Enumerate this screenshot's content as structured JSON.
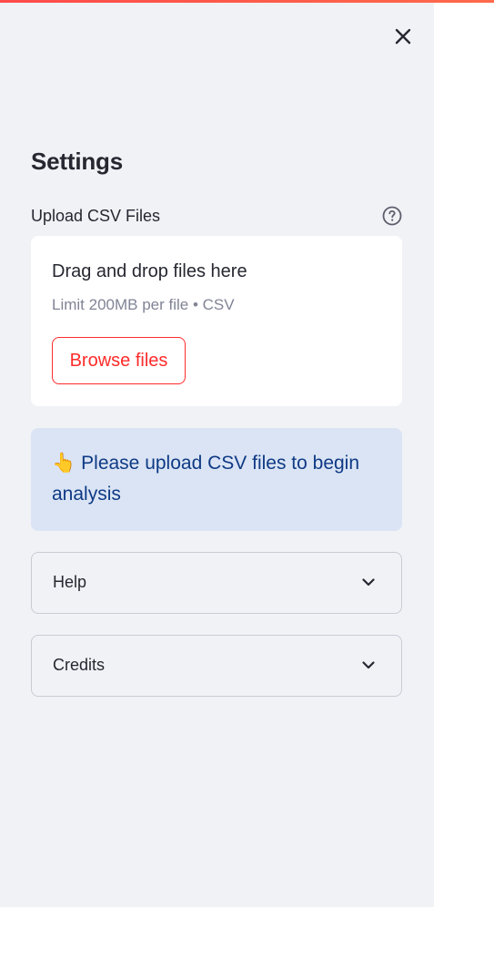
{
  "sidebar": {
    "close_icon": "close-icon",
    "heading": "Settings",
    "uploader": {
      "label": "Upload CSV Files",
      "help_icon": "question-circle-icon",
      "drop_title": "Drag and drop files here",
      "drop_subtitle": "Limit 200MB per file • CSV",
      "browse_label": "Browse files"
    },
    "info": {
      "emoji": "👆",
      "text": "Please upload CSV files to begin analysis"
    },
    "expanders": [
      {
        "label": "Help",
        "icon": "chevron-down-icon"
      },
      {
        "label": "Credits",
        "icon": "chevron-down-icon"
      }
    ]
  },
  "colors": {
    "accent": "#ff4b4b",
    "sidebar_bg": "#f0f2f6",
    "info_bg": "#dae4f4",
    "info_text": "#0f3a85",
    "text": "#262730",
    "muted": "#808495"
  }
}
